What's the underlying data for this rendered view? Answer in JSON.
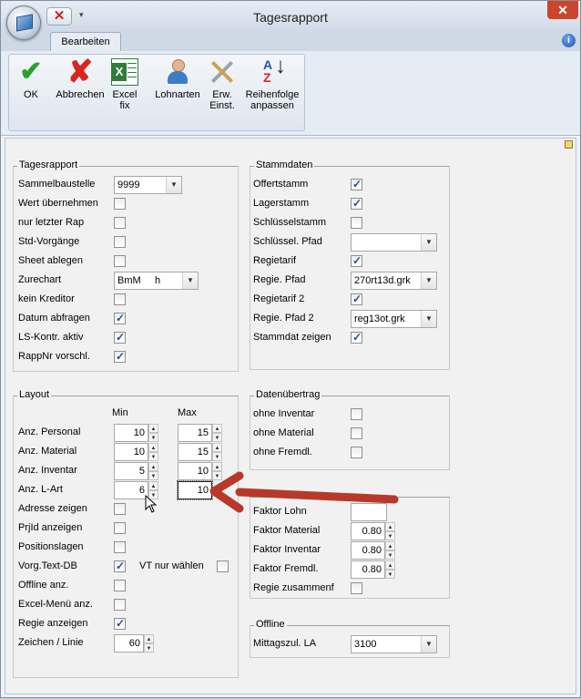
{
  "window": {
    "title": "Tagesrapport",
    "close_glyph": "✕",
    "qa_close_glyph": "✕",
    "qa_menu_glyph": "▾"
  },
  "tabs": [
    {
      "label": "Bearbeiten"
    }
  ],
  "help_glyph": "i",
  "ribbon": {
    "ok": "OK",
    "abbrechen": "Abbrechen",
    "excel_fix": [
      "Excel",
      "fix"
    ],
    "lohnarten": "Lohnarten",
    "erw_einst": [
      "Erw.",
      "Einst."
    ],
    "reihenfolge": [
      "Reihenfolge",
      "anpassen"
    ]
  },
  "tagesrapport": {
    "title": "Tagesrapport",
    "sammelbaustelle": {
      "label": "Sammelbaustelle",
      "value": "9999"
    },
    "wert_uebernehmen": {
      "label": "Wert übernehmen",
      "checked": false
    },
    "nur_letzter_rap": {
      "label": "nur letzter Rap",
      "checked": false
    },
    "std_vorgaenge": {
      "label": "Std-Vorgänge",
      "checked": false
    },
    "sheet_ablegen": {
      "label": "Sheet ablegen",
      "checked": false
    },
    "zurechart": {
      "label": "Zurechart",
      "value": "BmM     h"
    },
    "kein_kreditor": {
      "label": "kein Kreditor",
      "checked": false
    },
    "datum_abfragen": {
      "label": "Datum abfragen",
      "checked": true
    },
    "ls_kontr": {
      "label": "LS-Kontr. aktiv",
      "checked": true
    },
    "rappnr": {
      "label": "RappNr vorschl.",
      "checked": true
    }
  },
  "stammdaten": {
    "title": "Stammdaten",
    "offertstamm": {
      "label": "Offertstamm",
      "checked": true
    },
    "lagerstamm": {
      "label": "Lagerstamm",
      "checked": true
    },
    "schluesselstamm": {
      "label": "Schlüsselstamm",
      "checked": false
    },
    "schluessel_pfad": {
      "label": "Schlüssel. Pfad",
      "value": ""
    },
    "regietarif": {
      "label": "Regietarif",
      "checked": true
    },
    "regie_pfad": {
      "label": "Regie. Pfad",
      "value": "270rt13d.grk"
    },
    "regietarif2": {
      "label": "Regietarif 2",
      "checked": true
    },
    "regie_pfad2": {
      "label": "Regie. Pfad 2",
      "value": "reg13ot.grk"
    },
    "stammdat_zeigen": {
      "label": "Stammdat zeigen",
      "checked": true
    }
  },
  "layout": {
    "title": "Layout",
    "min": "Min",
    "max": "Max",
    "anz_personal": {
      "label": "Anz. Personal",
      "min": "10",
      "max": "15"
    },
    "anz_material": {
      "label": "Anz. Material",
      "min": "10",
      "max": "15"
    },
    "anz_inventar": {
      "label": "Anz. Inventar",
      "min": "5",
      "max": "10"
    },
    "anz_lart": {
      "label": "Anz. L-Art",
      "min": "6",
      "max": "10"
    },
    "adresse_zeigen": {
      "label": "Adresse zeigen",
      "checked": false
    },
    "prjid_anzeigen": {
      "label": "PrjId anzeigen",
      "checked": false
    },
    "positionslagen": {
      "label": "Positionslagen",
      "checked": false
    },
    "vorg_text_db": {
      "label": "Vorg.Text-DB",
      "checked": true
    },
    "vt_nur_waehlen": {
      "label": "VT nur wählen",
      "checked": false
    },
    "offline_anz": {
      "label": "Offline anz.",
      "checked": false
    },
    "excel_menu": {
      "label": "Excel-Menü anz.",
      "checked": false
    },
    "regie_anzeigen": {
      "label": "Regie anzeigen",
      "checked": true
    },
    "zeichen_linie": {
      "label": "Zeichen / Linie",
      "value": "60"
    }
  },
  "datenuebertrag": {
    "title": "Datenübertrag",
    "ohne_inventar": {
      "label": "ohne Inventar",
      "checked": false
    },
    "ohne_material": {
      "label": "ohne Material",
      "checked": false
    },
    "ohne_fremdl": {
      "label": "ohne Fremdl.",
      "checked": false
    }
  },
  "regiefaktoren": {
    "faktor_lohn": {
      "label": "Faktor Lohn",
      "value": ""
    },
    "faktor_material": {
      "label": "Faktor Material",
      "value": "0.80"
    },
    "faktor_inventar": {
      "label": "Faktor Inventar",
      "value": "0.80"
    },
    "faktor_fremdl": {
      "label": "Faktor Fremdl.",
      "value": "0.80"
    },
    "regie_zusammenf": {
      "label": "Regie zusammenf",
      "checked": false
    }
  },
  "offline": {
    "title": "Offline",
    "mittagszul": {
      "label": "Mittagszul. LA",
      "value": "3100"
    }
  },
  "colors": {
    "annotation_arrow": "#c0392b",
    "accent": "#1e56b0"
  }
}
